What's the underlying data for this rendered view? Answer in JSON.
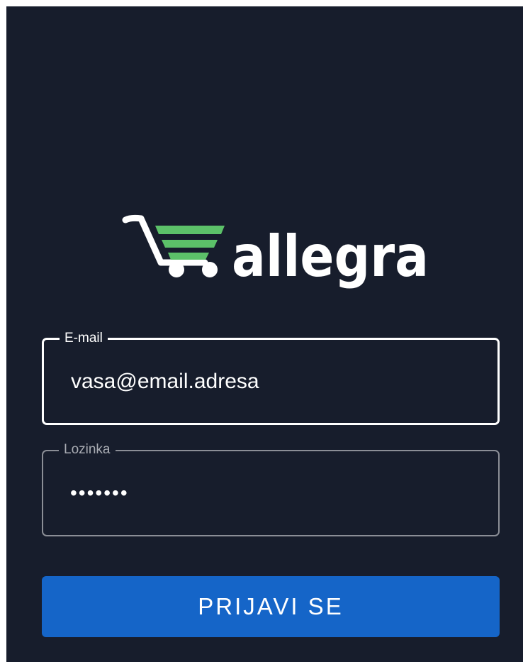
{
  "logo": {
    "icon": "shopping-cart-icon",
    "text": "allegra",
    "accent_color": "#5cc169",
    "text_color": "#ffffff"
  },
  "form": {
    "email": {
      "label": "E-mail",
      "placeholder": "vasa@email.adresa",
      "value": ""
    },
    "password": {
      "label": "Lozinka",
      "value": "*******"
    },
    "submit_label": "PRIJAVI SE"
  },
  "colors": {
    "background": "#171d2c",
    "primary": "#1565c8"
  }
}
